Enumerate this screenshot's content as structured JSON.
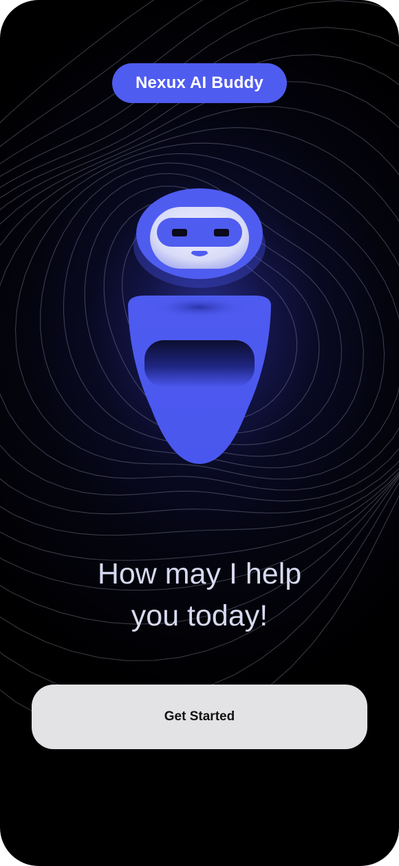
{
  "header": {
    "badge_label": "Nexux AI Buddy"
  },
  "hero": {
    "illustration": "robot-mascot",
    "headline_line1": "How may I help",
    "headline_line2": "you today!"
  },
  "actions": {
    "primary_label": "Get Started"
  },
  "colors": {
    "background": "#000000",
    "accent": "#4f5cf0",
    "button_bg": "#e3e3e5",
    "headline_text": "#d7d9ef"
  }
}
